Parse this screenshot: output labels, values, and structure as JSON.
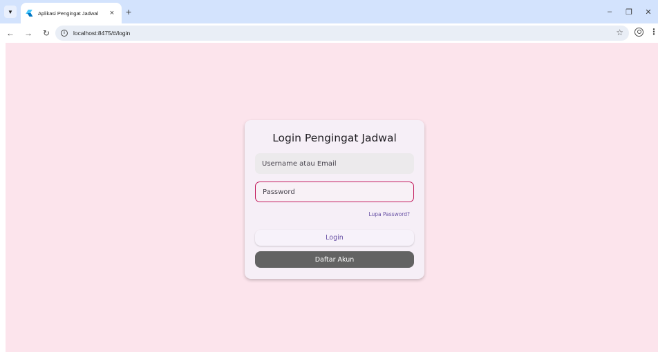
{
  "browser": {
    "tab_title": "Aplikasi Pengingat Jadwal",
    "tab_close_glyph": "×",
    "new_tab_glyph": "+",
    "url": "localhost:8475/#/login",
    "icons": [
      "tab-search-icon",
      "flutter-favicon-icon",
      "back-icon",
      "forward-icon",
      "reload-icon",
      "site-info-icon",
      "bookmark-star-icon",
      "profile-icon",
      "kebab-menu-icon",
      "minimize-icon",
      "restore-icon",
      "close-window-icon"
    ]
  },
  "login": {
    "title": "Login Pengingat Jadwal",
    "username_placeholder": "Username atau Email",
    "password_placeholder": "Password",
    "forgot_label": "Lupa Password?",
    "login_label": "Login",
    "register_label": "Daftar Akun"
  },
  "colors": {
    "page_background": "#fce4ec",
    "card_background": "#f6eff7",
    "accent": "#6750a4",
    "focus_border": "#c2185b",
    "register_button": "#636363"
  }
}
